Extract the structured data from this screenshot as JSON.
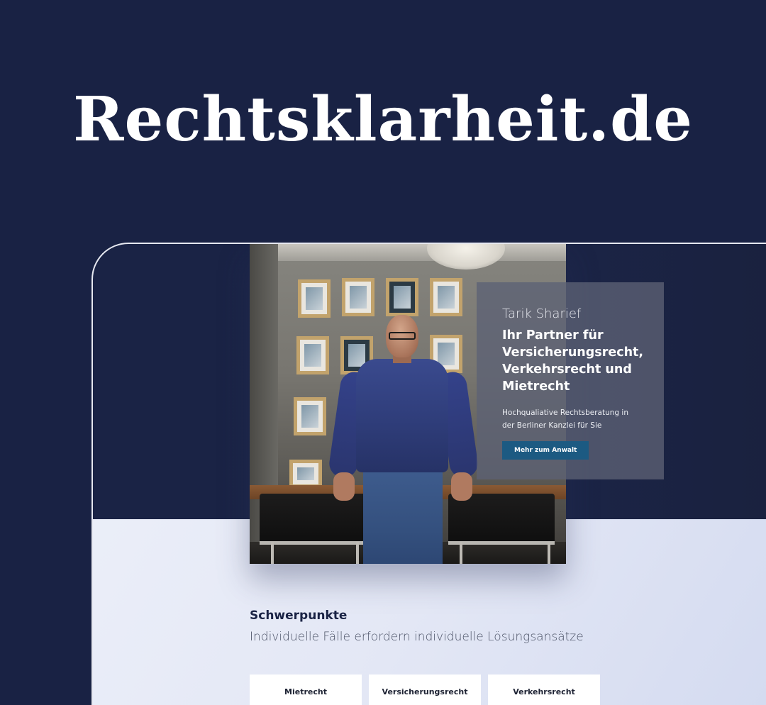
{
  "brand": {
    "title": "Rechtsklarheit.de"
  },
  "hero": {
    "name": "Tarik Sharief",
    "headline": "Ihr Partner für Versicherungsrecht, Verkehrsrecht und Mietrecht",
    "subtext": "Hochqualiative Rechtsberatung in der Berliner Kanzlei für Sie",
    "button_label": "Mehr zum Anwalt"
  },
  "focus": {
    "title": "Schwerpunkte",
    "subtitle": "Individuelle Fälle erfordern individuelle Lösungsansätze",
    "tabs": [
      {
        "label": "Mietrecht"
      },
      {
        "label": "Versicherungsrecht"
      },
      {
        "label": "Verkehrsrecht"
      }
    ]
  },
  "colors": {
    "navy": "#192244",
    "hero_bg": "#1b2446",
    "button": "#1c5a82",
    "light_bg": "#e3e7f5"
  },
  "icons": {
    "portrait": "lawyer-portrait-photo"
  }
}
